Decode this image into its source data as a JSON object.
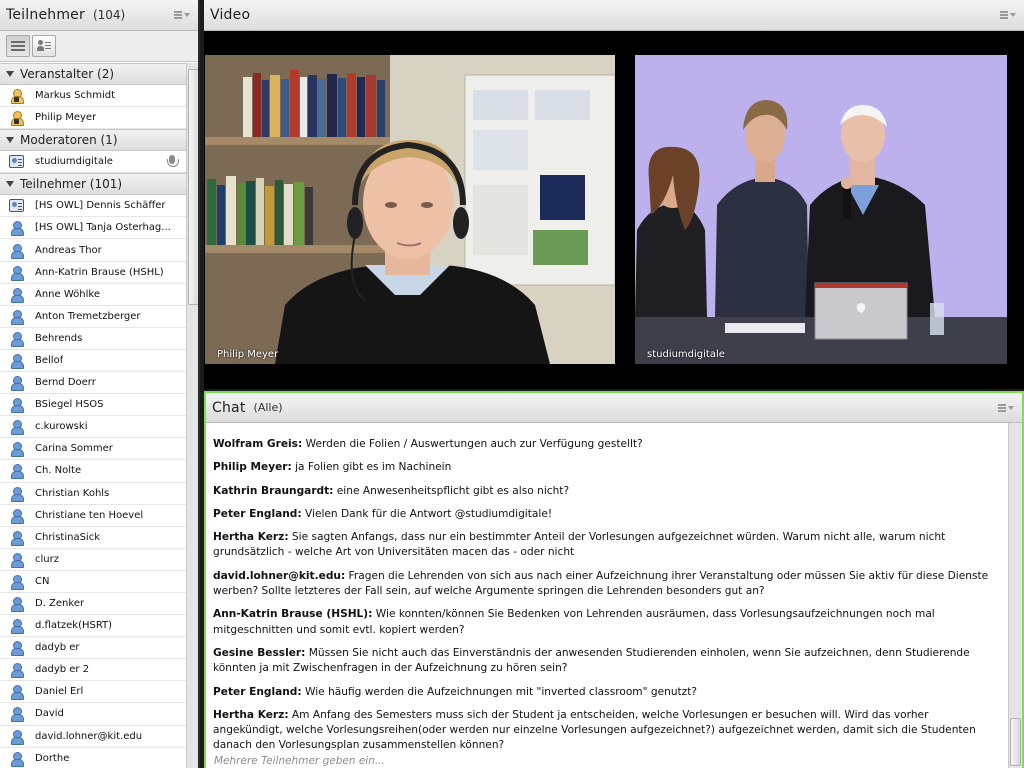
{
  "colors": {
    "active_pod_border": "#7be04f",
    "host_icon": "#f0c35a",
    "participant_icon": "#6d9bd6"
  },
  "attendees": {
    "title": "Teilnehmer",
    "count": "(104)",
    "groups": [
      {
        "label": "Veranstalter (2)",
        "members": [
          {
            "name": "Markus Schmidt",
            "icon": "host-icon"
          },
          {
            "name": "Philip Meyer",
            "icon": "host-icon"
          }
        ]
      },
      {
        "label": "Moderatoren (1)",
        "members": [
          {
            "name": "studiumdigitale",
            "icon": "presenter-icon"
          }
        ]
      },
      {
        "label": "Teilnehmer (101)",
        "members": [
          {
            "name": "[HS OWL] Dennis Schäffer",
            "icon": "presenter-icon"
          },
          {
            "name": "[HS OWL] Tanja Osterhag...",
            "icon": "participant-icon"
          },
          {
            "name": "Andreas Thor",
            "icon": "participant-icon"
          },
          {
            "name": "Ann-Katrin Brause (HSHL)",
            "icon": "participant-icon"
          },
          {
            "name": "Anne Wöhlke",
            "icon": "participant-icon"
          },
          {
            "name": "Anton Tremetzberger",
            "icon": "participant-icon"
          },
          {
            "name": "Behrends",
            "icon": "participant-icon"
          },
          {
            "name": "Bellof",
            "icon": "participant-icon"
          },
          {
            "name": "Bernd Doerr",
            "icon": "participant-icon"
          },
          {
            "name": "BSiegel HSOS",
            "icon": "participant-icon"
          },
          {
            "name": "c.kurowski",
            "icon": "participant-icon"
          },
          {
            "name": "Carina Sommer",
            "icon": "participant-icon"
          },
          {
            "name": "Ch. Nolte",
            "icon": "participant-icon"
          },
          {
            "name": "Christian Kohls",
            "icon": "participant-icon"
          },
          {
            "name": "Christiane ten Hoevel",
            "icon": "participant-icon"
          },
          {
            "name": "ChristinaSick",
            "icon": "participant-icon"
          },
          {
            "name": "clurz",
            "icon": "participant-icon"
          },
          {
            "name": "CN",
            "icon": "participant-icon"
          },
          {
            "name": "D. Zenker",
            "icon": "participant-icon"
          },
          {
            "name": "d.flatzek(HSRT)",
            "icon": "participant-icon"
          },
          {
            "name": "dadyb er",
            "icon": "participant-icon"
          },
          {
            "name": "dadyb er 2",
            "icon": "participant-icon"
          },
          {
            "name": "Daniel Erl",
            "icon": "participant-icon"
          },
          {
            "name": "David",
            "icon": "participant-icon"
          },
          {
            "name": "david.lohner@kit.edu",
            "icon": "participant-icon"
          },
          {
            "name": "Dorthe",
            "icon": "participant-icon"
          }
        ]
      }
    ]
  },
  "video": {
    "title": "Video",
    "tiles": [
      {
        "label": "Philip Meyer"
      },
      {
        "label": "studiumdigitale"
      }
    ]
  },
  "chat": {
    "title": "Chat",
    "scope": "(Alle)",
    "typing": "Mehrere Teilnehmer geben ein...",
    "messages": [
      {
        "sender": "Wolfram Greis:",
        "text": " Werden die Folien / Auswertungen auch zur Verfügung gestellt?"
      },
      {
        "sender": "Philip Meyer:",
        "text": " ja Folien gibt es im Nachinein"
      },
      {
        "sender": "Kathrin Braungardt:",
        "text": " eine Anwesenheitspflicht gibt es also nicht?"
      },
      {
        "sender": "Peter England:",
        "text": " Vielen Dank für die Antwort @studiumdigitale!"
      },
      {
        "sender": "Hertha Kerz:",
        "text": " Sie sagten Anfangs, dass nur ein bestimmter Anteil der Vorlesungen aufgezeichnet würden. Warum nicht alle, warum nicht grundsätzlich - welche Art von Universitäten macen das - oder nicht"
      },
      {
        "sender": "david.lohner@kit.edu:",
        "text": " Fragen die Lehrenden von sich aus nach einer Aufzeichnung ihrer Veranstaltung oder müssen Sie aktiv für diese Dienste werben? Sollte letzteres der Fall sein, auf welche Argumente springen die Lehrenden besonders gut an?"
      },
      {
        "sender": "Ann-Katrin Brause (HSHL):",
        "text": " Wie konnten/können Sie Bedenken von Lehrenden ausräumen, dass Vorlesungsaufzeichnungen noch mal mitgeschnitten und somit evtl. kopiert werden?"
      },
      {
        "sender": "Gesine Bessler:",
        "text": " Müssen Sie nicht auch das Einverständnis der anwesenden Studierenden einholen, wenn Sie aufzeichnen, denn Studierende könnten ja mit Zwischenfragen in der Aufzeichnung zu hören sein?"
      },
      {
        "sender": "Peter England:",
        "text": " Wie häufig werden die Aufzeichnungen mit \"inverted classroom\" genutzt?"
      },
      {
        "sender": "Hertha Kerz:",
        "text": " Am Anfang des Semesters muss sich der Student ja entscheiden, welche Vorlesungen er besuchen will. Wird das vorher angekündigt, welche Vorlesungsreihen(oder werden nur einzelne Vorlesungen aufgezeichnet?)  aufgezeichnet werden, damit sich die Studenten danach den Vorlesungsplan zusammenstellen können?"
      }
    ]
  }
}
